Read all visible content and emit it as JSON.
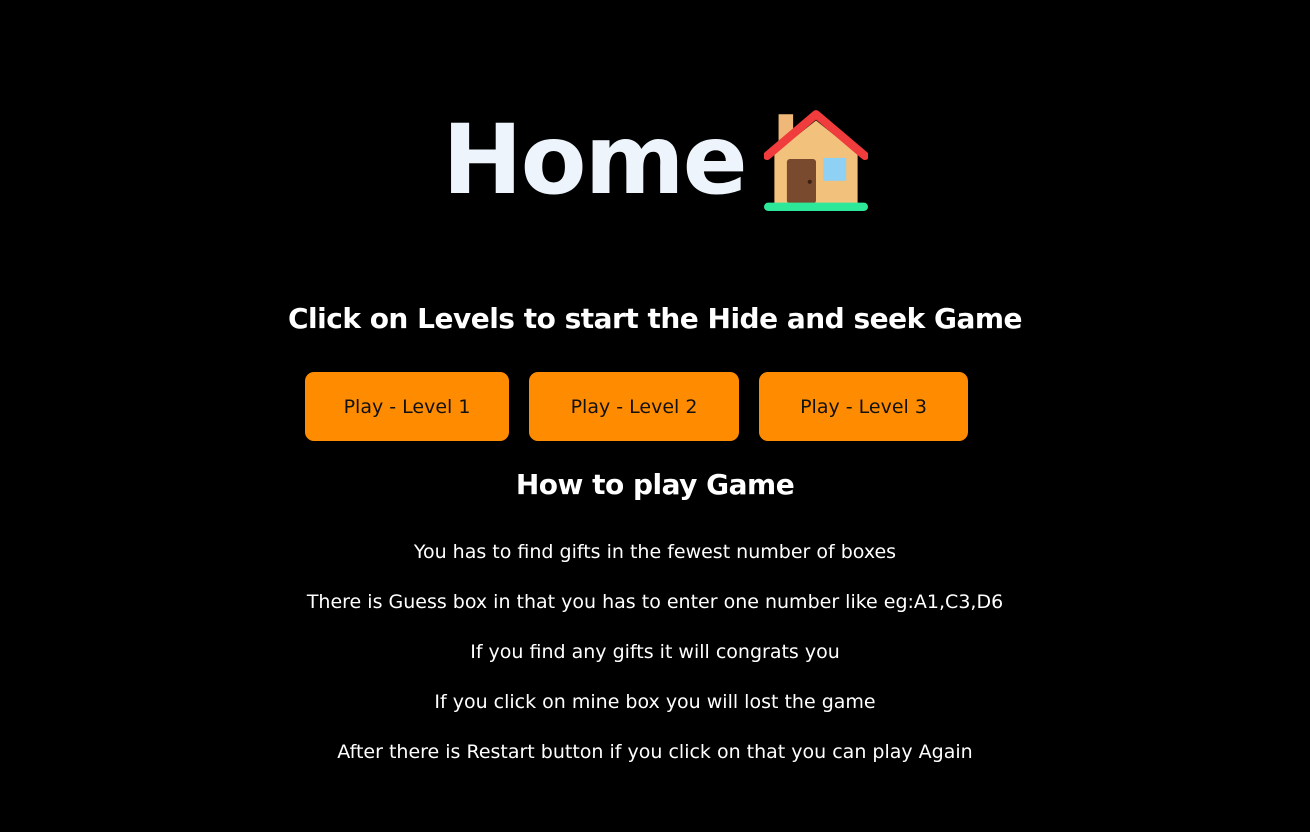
{
  "header": {
    "title": "Home",
    "icon": "house-icon"
  },
  "intro": {
    "text": "Click on Levels to start the Hide and seek Game"
  },
  "levels": [
    {
      "label": "Play - Level 1"
    },
    {
      "label": "Play - Level 2"
    },
    {
      "label": "Play - Level 3"
    }
  ],
  "how_to": {
    "heading": "How to play Game",
    "steps": [
      "You has to find gifts in the fewest number of boxes",
      "There is Guess box in that you has to enter one number like eg:A1,C3,D6",
      "If you find any gifts it will congrats you",
      "If you click on mine box you will lost the game",
      "After there is Restart button if you click on that you can play Again"
    ]
  },
  "colors": {
    "background": "#000000",
    "button": "#ff8c00",
    "text": "#ffffff"
  }
}
